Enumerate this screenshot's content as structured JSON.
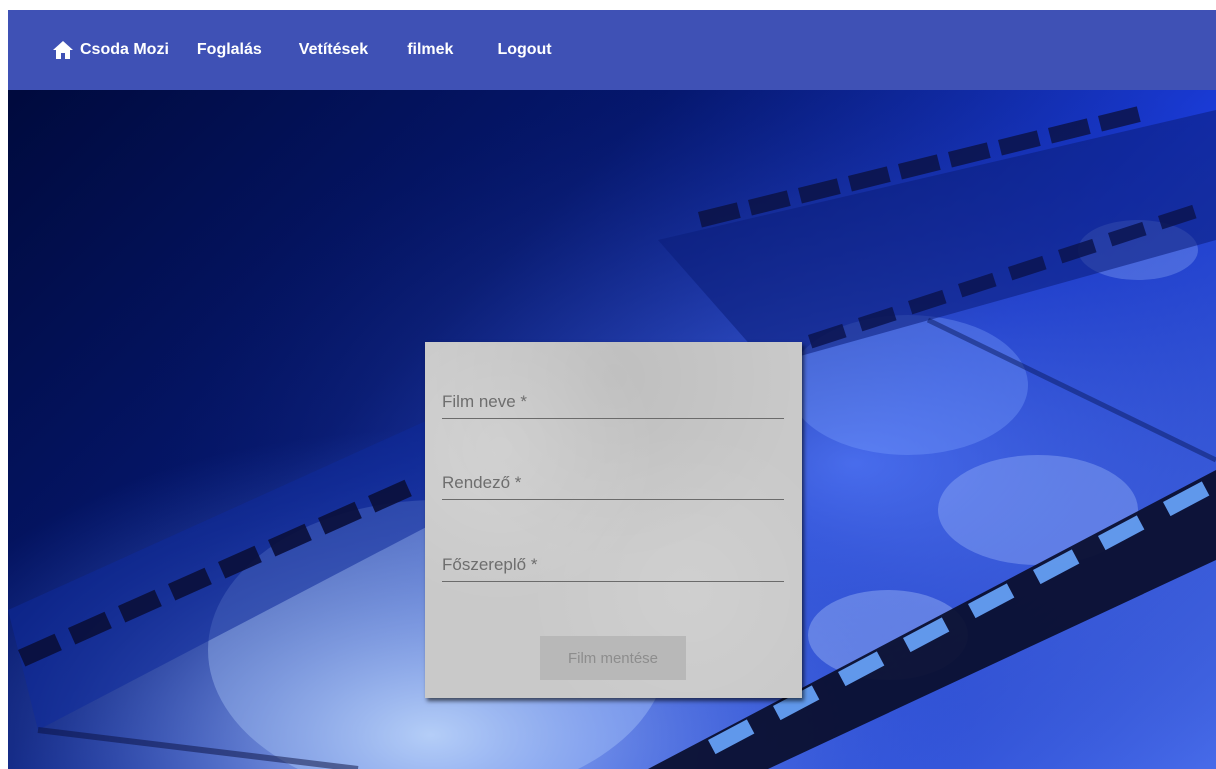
{
  "navbar": {
    "brand": "Csoda Mozi",
    "links": [
      "Foglalás",
      "Vetítések",
      "filmek",
      "Logout"
    ],
    "color": "#3f51b5"
  },
  "form": {
    "film_name_placeholder": "Film neve *",
    "director_placeholder": "Rendező *",
    "lead_actor_placeholder": "Főszereplő *",
    "save_label": "Film mentése"
  }
}
